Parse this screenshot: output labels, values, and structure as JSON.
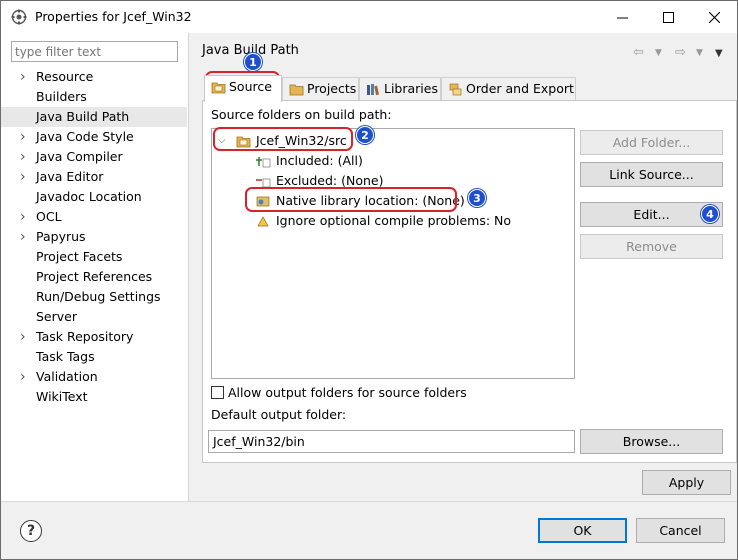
{
  "window": {
    "title": "Properties for Jcef_Win32",
    "minimize_icon": "minimize-icon",
    "maximize_icon": "maximize-icon",
    "close_icon": "close-icon"
  },
  "sidebar": {
    "filter_placeholder": "type filter text",
    "items": [
      {
        "label": "Resource",
        "expandable": true
      },
      {
        "label": "Builders",
        "expandable": false
      },
      {
        "label": "Java Build Path",
        "expandable": false,
        "selected": true
      },
      {
        "label": "Java Code Style",
        "expandable": true
      },
      {
        "label": "Java Compiler",
        "expandable": true
      },
      {
        "label": "Java Editor",
        "expandable": true
      },
      {
        "label": "Javadoc Location",
        "expandable": false
      },
      {
        "label": "OCL",
        "expandable": true
      },
      {
        "label": "Papyrus",
        "expandable": true
      },
      {
        "label": "Project Facets",
        "expandable": false
      },
      {
        "label": "Project References",
        "expandable": false
      },
      {
        "label": "Run/Debug Settings",
        "expandable": false
      },
      {
        "label": "Server",
        "expandable": false
      },
      {
        "label": "Task Repository",
        "expandable": true
      },
      {
        "label": "Task Tags",
        "expandable": false
      },
      {
        "label": "Validation",
        "expandable": true
      },
      {
        "label": "WikiText",
        "expandable": false
      }
    ]
  },
  "page": {
    "title": "Java Build Path",
    "tabs": [
      {
        "label": "Source",
        "icon": "source-folder-icon",
        "active": true
      },
      {
        "label": "Projects",
        "icon": "projects-icon"
      },
      {
        "label": "Libraries",
        "icon": "libraries-icon"
      },
      {
        "label": "Order and Export",
        "icon": "order-export-icon"
      }
    ],
    "source_label": "Source folders on build path:",
    "tree": {
      "root": "Jcef_Win32/src",
      "children": [
        "Included: (All)",
        "Excluded: (None)",
        "Native library location: (None)",
        "Ignore optional compile problems: No"
      ]
    },
    "buttons": {
      "add_folder": "Add Folder...",
      "link_source": "Link Source...",
      "edit": "Edit...",
      "remove": "Remove",
      "browse": "Browse..."
    },
    "allow_output_label": "Allow output folders for source folders",
    "default_output_label": "Default output folder:",
    "default_output_value": "Jcef_Win32/bin",
    "apply": "Apply"
  },
  "footer": {
    "ok": "OK",
    "cancel": "Cancel",
    "help_symbol": "?"
  },
  "annotations": [
    "1",
    "2",
    "3",
    "4"
  ],
  "colors": {
    "callout_red": "#d8232a",
    "badge_blue": "#1f4fd1",
    "primary_button_border": "#0078d7"
  }
}
